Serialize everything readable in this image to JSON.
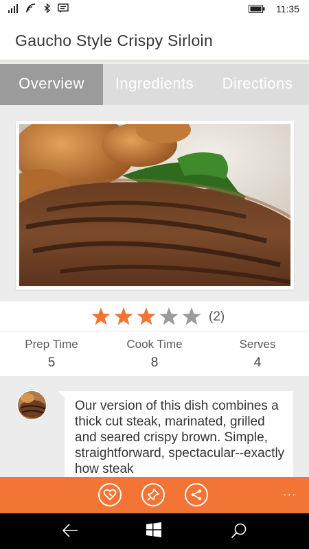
{
  "status_bar": {
    "time": "11:35",
    "icons": [
      "signal-icon",
      "wifi-icon",
      "bluetooth-icon",
      "message-icon",
      "battery-icon"
    ]
  },
  "title": "Gaucho Style Crispy Sirloin",
  "tabs": [
    {
      "label": "Overview",
      "active": true
    },
    {
      "label": "Ingredients",
      "active": false
    },
    {
      "label": "Directions",
      "active": false
    }
  ],
  "rating": {
    "stars": 3,
    "max": 5,
    "count": "(2)"
  },
  "stats": [
    {
      "label": "Prep Time",
      "value": "5"
    },
    {
      "label": "Cook Time",
      "value": "8"
    },
    {
      "label": "Serves",
      "value": "4"
    }
  ],
  "description": "Our version of this dish combines a thick cut steak, marinated, grilled and seared crispy brown. Simple, straightforward, spectacular--exactly how steak",
  "app_bar": {
    "buttons": [
      "favorite-icon",
      "pin-icon",
      "share-icon"
    ],
    "more": "..."
  },
  "nav_bar": {
    "buttons": [
      "back-icon",
      "windows-icon",
      "search-icon"
    ]
  },
  "colors": {
    "accent": "#f27535",
    "star_filled": "#f27535",
    "star_empty": "#9b9b9b",
    "active_tab": "#9b9b9b",
    "tab_bar": "#dcdcdc"
  }
}
